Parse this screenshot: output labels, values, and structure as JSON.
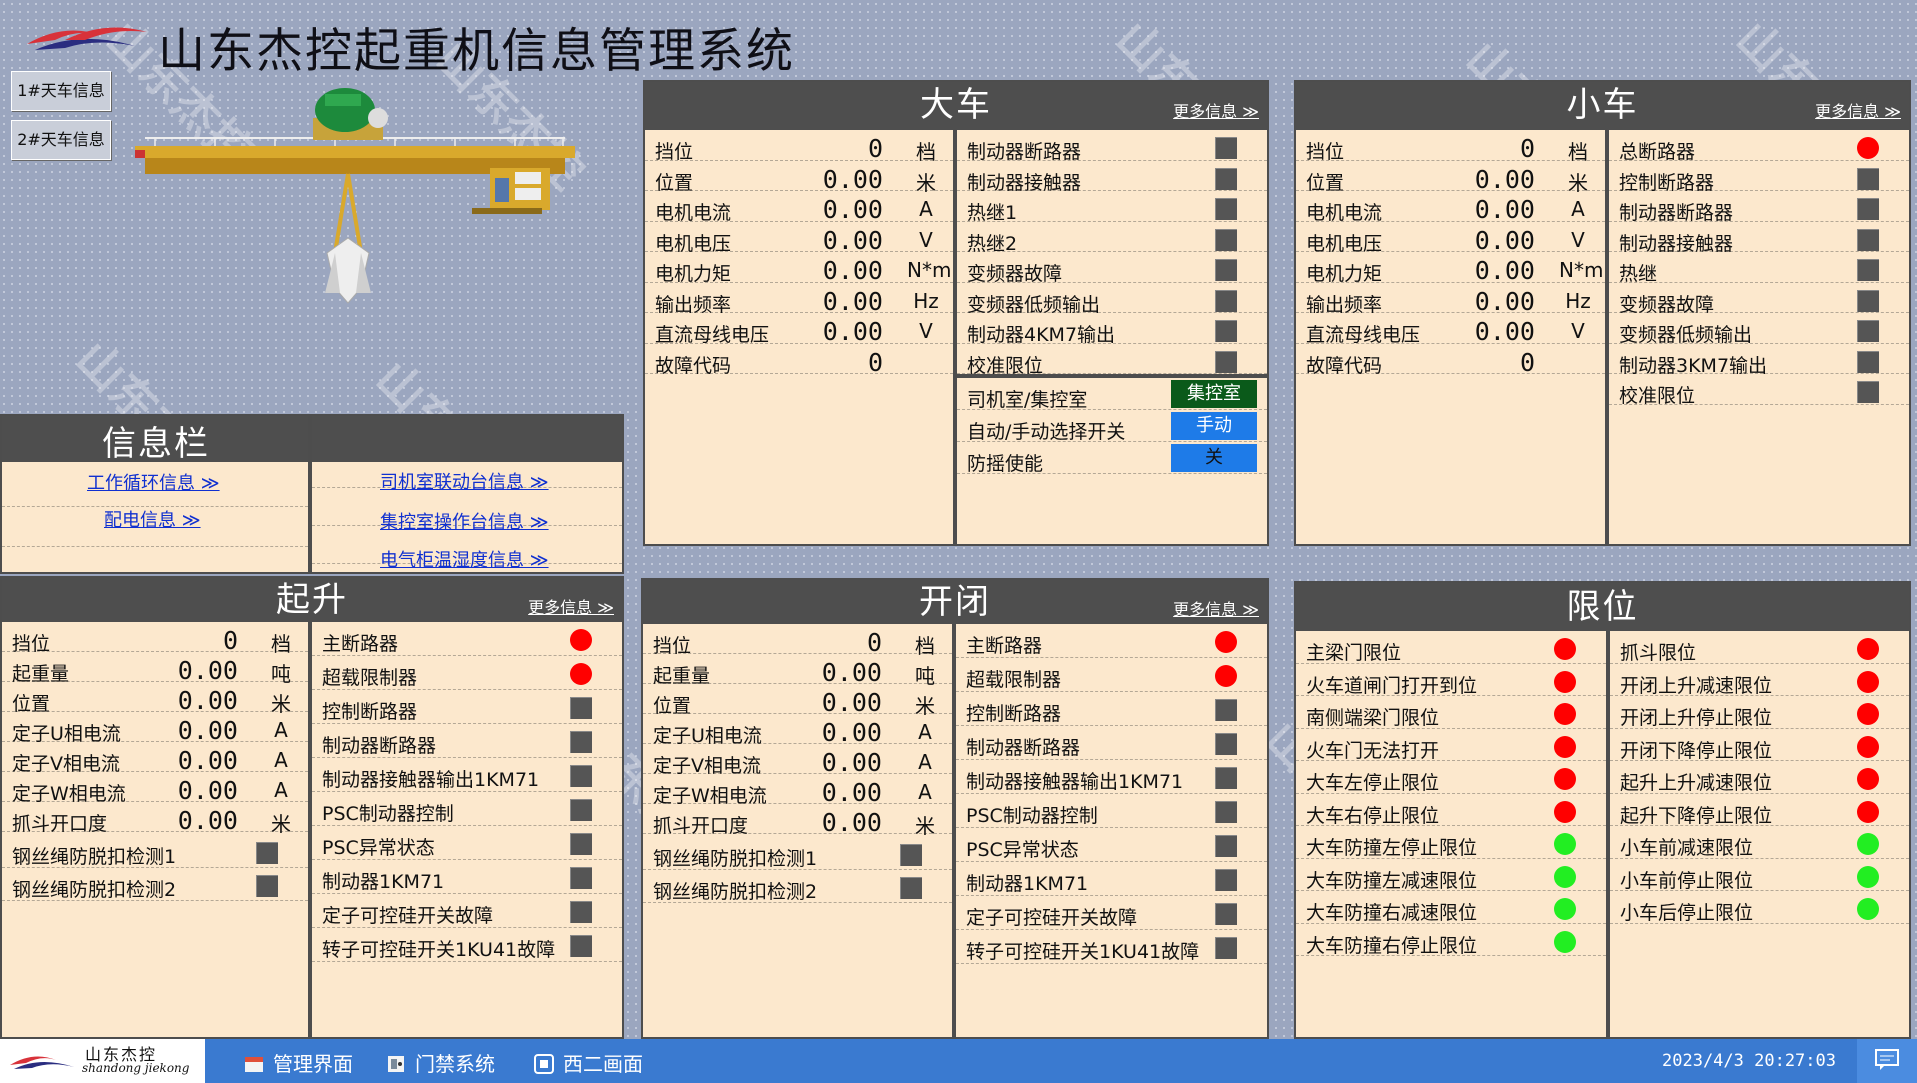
{
  "app_title": "山东杰控起重机信息管理系统",
  "crane_buttons": [
    "1#天车信息",
    "2#天车信息"
  ],
  "watermark": "山东杰控",
  "info_bar": {
    "title": "信息栏",
    "links_left": [
      "工作循环信息 ≫",
      "配电信息 ≫"
    ],
    "links_right": [
      "司机室联动台信息 ≫",
      "集控室操作台信息 ≫",
      "电气柜温湿度信息 ≫"
    ]
  },
  "more_info": "更多信息 ≫",
  "dache": {
    "title": "大车",
    "values": [
      {
        "label": "挡位",
        "value": "0",
        "unit": "档"
      },
      {
        "label": "位置",
        "value": "0.00",
        "unit": "米"
      },
      {
        "label": "电机电流",
        "value": "0.00",
        "unit": "A"
      },
      {
        "label": "电机电压",
        "value": "0.00",
        "unit": "V"
      },
      {
        "label": "电机力矩",
        "value": "0.00",
        "unit": "N*m"
      },
      {
        "label": "输出频率",
        "value": "0.00",
        "unit": "Hz"
      },
      {
        "label": "直流母线电压",
        "value": "0.00",
        "unit": "V"
      },
      {
        "label": "故障代码",
        "value": "0",
        "unit": ""
      }
    ],
    "status": [
      "制动器断路器",
      "制动器接触器",
      "热继1",
      "热继2",
      "变频器故障",
      "变频器低频输出",
      "制动器4KM7输出",
      "校准限位"
    ],
    "switches": [
      {
        "label": "司机室/集控室",
        "state": "集控室",
        "color": "#0a5a1a",
        "text_color": "#ffffff"
      },
      {
        "label": "自动/手动选择开关",
        "state": "手动",
        "color": "#1e7be8",
        "text_color": "#ffffff"
      },
      {
        "label": "防摇使能",
        "state": "关",
        "color": "#1e7be8",
        "text_color": "#111111"
      }
    ]
  },
  "xiaoche": {
    "title": "小车",
    "values": [
      {
        "label": "挡位",
        "value": "0",
        "unit": "档"
      },
      {
        "label": "位置",
        "value": "0.00",
        "unit": "米"
      },
      {
        "label": "电机电流",
        "value": "0.00",
        "unit": "A"
      },
      {
        "label": "电机电压",
        "value": "0.00",
        "unit": "V"
      },
      {
        "label": "电机力矩",
        "value": "0.00",
        "unit": "N*m"
      },
      {
        "label": "输出频率",
        "value": "0.00",
        "unit": "Hz"
      },
      {
        "label": "直流母线电压",
        "value": "0.00",
        "unit": "V"
      },
      {
        "label": "故障代码",
        "value": "0",
        "unit": ""
      }
    ],
    "status": [
      {
        "label": "总断路器",
        "state": "red"
      },
      {
        "label": "控制断路器",
        "state": "gray"
      },
      {
        "label": "制动器断路器",
        "state": "gray"
      },
      {
        "label": "制动器接触器",
        "state": "gray"
      },
      {
        "label": "热继",
        "state": "gray"
      },
      {
        "label": "变频器故障",
        "state": "gray"
      },
      {
        "label": "变频器低频输出",
        "state": "gray"
      },
      {
        "label": "制动器3KM7输出",
        "state": "gray"
      },
      {
        "label": "校准限位",
        "state": "gray"
      }
    ]
  },
  "qisheng": {
    "title": "起升",
    "values": [
      {
        "label": "挡位",
        "value": "0",
        "unit": "档"
      },
      {
        "label": "起重量",
        "value": "0.00",
        "unit": "吨"
      },
      {
        "label": "位置",
        "value": "0.00",
        "unit": "米"
      },
      {
        "label": "定子U相电流",
        "value": "0.00",
        "unit": "A"
      },
      {
        "label": "定子V相电流",
        "value": "0.00",
        "unit": "A"
      },
      {
        "label": "定子W相电流",
        "value": "0.00",
        "unit": "A"
      },
      {
        "label": "抓斗开口度",
        "value": "0.00",
        "unit": "米"
      }
    ],
    "checks": [
      "钢丝绳防脱扣检测1",
      "钢丝绳防脱扣检测2"
    ],
    "status": [
      {
        "label": "主断路器",
        "state": "red"
      },
      {
        "label": "超载限制器",
        "state": "red"
      },
      {
        "label": "控制断路器",
        "state": "gray"
      },
      {
        "label": "制动器断路器",
        "state": "gray"
      },
      {
        "label": "制动器接触器输出1KM71",
        "state": "gray"
      },
      {
        "label": "PSC制动器控制",
        "state": "gray"
      },
      {
        "label": "PSC异常状态",
        "state": "gray"
      },
      {
        "label": "制动器1KM71",
        "state": "gray"
      },
      {
        "label": "定子可控硅开关故障",
        "state": "gray"
      },
      {
        "label": "转子可控硅开关1KU41故障",
        "state": "gray"
      }
    ]
  },
  "kaibi": {
    "title": "开闭",
    "values": [
      {
        "label": "挡位",
        "value": "0",
        "unit": "档"
      },
      {
        "label": "起重量",
        "value": "0.00",
        "unit": "吨"
      },
      {
        "label": "位置",
        "value": "0.00",
        "unit": "米"
      },
      {
        "label": "定子U相电流",
        "value": "0.00",
        "unit": "A"
      },
      {
        "label": "定子V相电流",
        "value": "0.00",
        "unit": "A"
      },
      {
        "label": "定子W相电流",
        "value": "0.00",
        "unit": "A"
      },
      {
        "label": "抓斗开口度",
        "value": "0.00",
        "unit": "米"
      }
    ],
    "checks": [
      "钢丝绳防脱扣检测1",
      "钢丝绳防脱扣检测2"
    ],
    "status": [
      {
        "label": "主断路器",
        "state": "red"
      },
      {
        "label": "超载限制器",
        "state": "red"
      },
      {
        "label": "控制断路器",
        "state": "gray"
      },
      {
        "label": "制动器断路器",
        "state": "gray"
      },
      {
        "label": "制动器接触器输出1KM71",
        "state": "gray"
      },
      {
        "label": "PSC制动器控制",
        "state": "gray"
      },
      {
        "label": "PSC异常状态",
        "state": "gray"
      },
      {
        "label": "制动器1KM71",
        "state": "gray"
      },
      {
        "label": "定子可控硅开关故障",
        "state": "gray"
      },
      {
        "label": "转子可控硅开关1KU41故障",
        "state": "gray"
      }
    ]
  },
  "xianwei": {
    "title": "限位",
    "left": [
      {
        "label": "主梁门限位",
        "state": "red"
      },
      {
        "label": "火车道闸门打开到位",
        "state": "red"
      },
      {
        "label": "南侧端梁门限位",
        "state": "red"
      },
      {
        "label": "火车门无法打开",
        "state": "red"
      },
      {
        "label": "大车左停止限位",
        "state": "red"
      },
      {
        "label": "大车右停止限位",
        "state": "red"
      },
      {
        "label": "大车防撞左停止限位",
        "state": "green"
      },
      {
        "label": "大车防撞左减速限位",
        "state": "green"
      },
      {
        "label": "大车防撞右减速限位",
        "state": "green"
      },
      {
        "label": "大车防撞右停止限位",
        "state": "green"
      }
    ],
    "right": [
      {
        "label": "抓斗限位",
        "state": "red"
      },
      {
        "label": "开闭上升减速限位",
        "state": "red"
      },
      {
        "label": "开闭上升停止限位",
        "state": "red"
      },
      {
        "label": "开闭下降停止限位",
        "state": "red"
      },
      {
        "label": "起升上升减速限位",
        "state": "red"
      },
      {
        "label": "起升下降停止限位",
        "state": "red"
      },
      {
        "label": "小车前减速限位",
        "state": "green"
      },
      {
        "label": "小车前停止限位",
        "state": "green"
      },
      {
        "label": "小车后停止限位",
        "state": "green"
      }
    ]
  },
  "taskbar": {
    "logo_cn": "山东杰控",
    "logo_en": "shandong jiekong",
    "items": [
      {
        "label": "管理界面",
        "icon": "management-icon"
      },
      {
        "label": "门禁系统",
        "icon": "access-control-icon"
      },
      {
        "label": "西二画面",
        "icon": "screen-icon"
      }
    ],
    "datetime": "2023/4/3 20:27:03"
  },
  "colors": {
    "panel_bg": "#fce8cd",
    "header_bg": "#4e4e4e",
    "red": "#ff0000",
    "green": "#22ee22",
    "taskbar": "#3a7ad0"
  }
}
